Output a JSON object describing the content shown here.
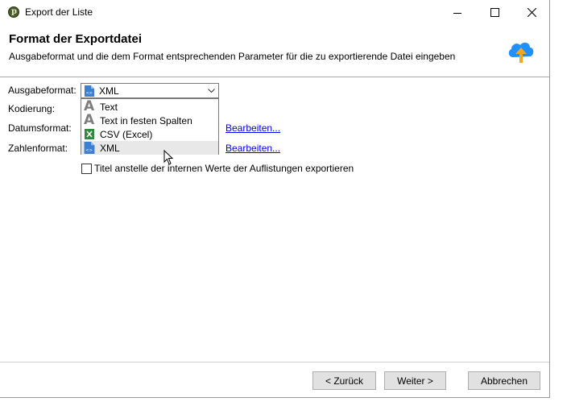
{
  "window": {
    "title": "Export der Liste",
    "app_icon_letter": "p",
    "app_icon_color": "#4b5a2a"
  },
  "header": {
    "title": "Format der Exportdatei",
    "subtitle": "Ausgabeformat und die dem Format entsprechenden Parameter für die zu exportierende Datei eingeben",
    "icon": "cloud-upload-icon",
    "cloud_color": "#1e90ff",
    "arrow_color": "#f5a623"
  },
  "form": {
    "output_format_label": "Ausgabeformat:",
    "encoding_label": "Kodierung:",
    "date_format_label": "Datumsformat:",
    "number_format_label": "Zahlenformat:",
    "output_format_value": "XML",
    "edit_date_link": "Bearbeiten...",
    "edit_number_link": "Bearbeiten...",
    "titles_checkbox_label": "Titel anstelle der internen Werte der Auflistungen exportieren",
    "titles_checkbox_checked": false
  },
  "dropdown": {
    "options": [
      {
        "label": "Text",
        "icon": "text-format-icon"
      },
      {
        "label": "Text in festen Spalten",
        "icon": "text-format-icon"
      },
      {
        "label": "CSV (Excel)",
        "icon": "excel-icon"
      },
      {
        "label": "XML",
        "icon": "xml-file-icon",
        "selected": true
      }
    ]
  },
  "footer": {
    "back_label": "< Zurück",
    "next_label": "Weiter >",
    "cancel_label": "Abbrechen"
  }
}
